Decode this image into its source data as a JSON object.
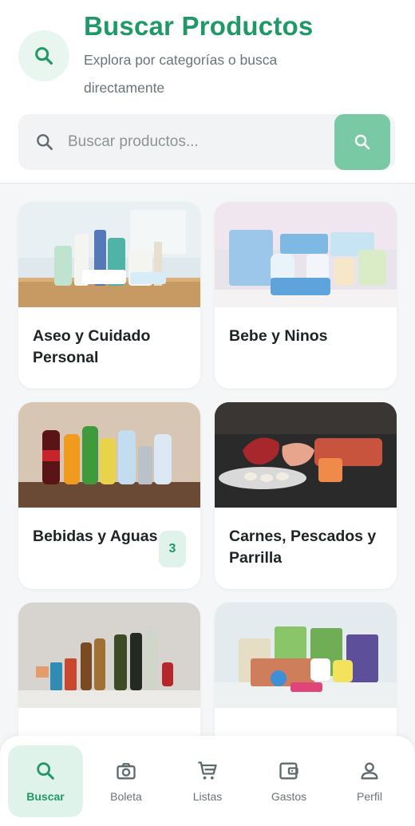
{
  "header": {
    "title": "Buscar Productos",
    "subtitle": "Explora por categorías o busca directamente",
    "icon": "search-icon"
  },
  "search": {
    "placeholder": "Buscar productos...",
    "value": ""
  },
  "categories": [
    {
      "label": "Aseo y Cuidado Personal",
      "badge": null
    },
    {
      "label": "Bebe y Ninos",
      "badge": null
    },
    {
      "label": "Bebidas y Aguas",
      "badge": "3"
    },
    {
      "label": "Carnes, Pescados y Parrilla",
      "badge": null
    },
    {
      "label": "",
      "badge": null
    },
    {
      "label": "",
      "badge": null
    }
  ],
  "nav": {
    "items": [
      {
        "label": "Buscar",
        "icon": "search-icon",
        "active": true
      },
      {
        "label": "Boleta",
        "icon": "camera-icon",
        "active": false
      },
      {
        "label": "Listas",
        "icon": "cart-icon",
        "active": false
      },
      {
        "label": "Gastos",
        "icon": "wallet-icon",
        "active": false
      },
      {
        "label": "Perfil",
        "icon": "person-icon",
        "active": false
      }
    ]
  },
  "colors": {
    "accent": "#1f9a66",
    "accent_light": "#dff3ea",
    "search_button": "#78c9a4"
  }
}
